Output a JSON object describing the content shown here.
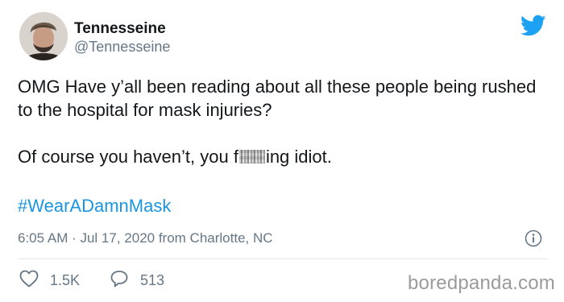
{
  "user": {
    "display_name": "Tennesseine",
    "handle": "@Tennesseine"
  },
  "tweet": {
    "line1": "OMG Have y’all been reading about all these people being rushed to the hospital for mask injuries?",
    "line2_before": "Of course you haven’t, you f",
    "line2_after": "ing idiot.",
    "hashtag": "#WearADamnMask",
    "timestamp": "6:05 AM · Jul 17, 2020 from Charlotte, NC"
  },
  "actions": {
    "likes": "1.5K",
    "replies": "513"
  },
  "watermark": "boredpanda.com",
  "icons": {
    "brand": "twitter-bird-icon",
    "info": "info-icon",
    "like": "heart-icon",
    "reply": "speech-bubble-icon"
  },
  "colors": {
    "brand_blue": "#1da1f2",
    "link_blue": "#1b95e0",
    "text": "#14171a",
    "secondary_text": "#657786",
    "divider": "#e1e8ed"
  }
}
